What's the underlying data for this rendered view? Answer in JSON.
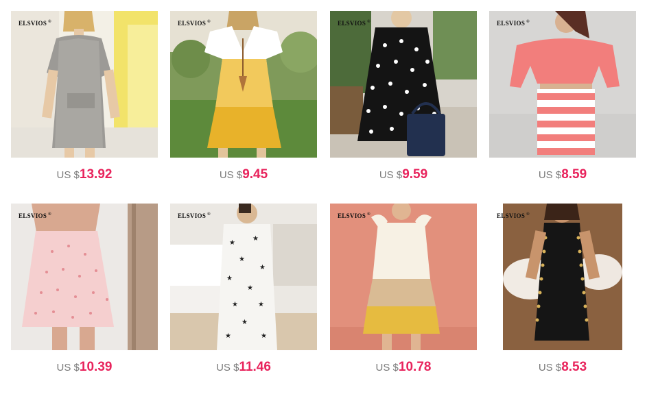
{
  "currency_prefix": "US $",
  "colors": {
    "price": "#e8235c",
    "currency_prefix": "#7a7a7a"
  },
  "products": [
    {
      "brand": "ELSVIOS",
      "price": "13.92",
      "image": "grey-linen-shift-dress"
    },
    {
      "brand": "ELSVIOS",
      "price": "9.45",
      "image": "yellow-white-tiered-v-neck-dress"
    },
    {
      "brand": "ELSVIOS",
      "price": "9.59",
      "image": "black-daisy-print-swing-dress"
    },
    {
      "brand": "ELSVIOS",
      "price": "8.59",
      "image": "pink-striped-two-piece-knit-set"
    },
    {
      "brand": "ELSVIOS",
      "price": "10.39",
      "image": "pink-floral-slip-mini-dress"
    },
    {
      "brand": "ELSVIOS",
      "price": "11.46",
      "image": "white-star-print-maxi-dress"
    },
    {
      "brand": "ELSVIOS",
      "price": "10.78",
      "image": "colorblock-tiered-ruffle-sleeve-dress"
    },
    {
      "brand": "ELSVIOS",
      "price": "8.53",
      "image": "black-buttoned-bodycon-dress"
    }
  ]
}
